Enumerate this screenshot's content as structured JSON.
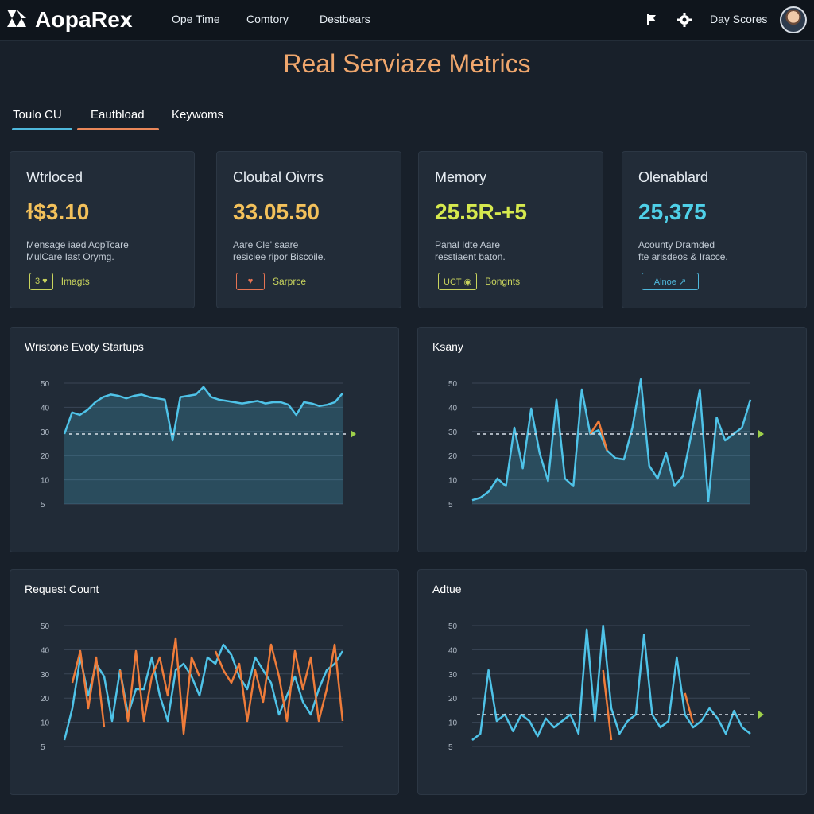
{
  "app": {
    "brand": "AopaRex"
  },
  "nav": {
    "items": [
      "Ope Time",
      "Comtory",
      "Destbears"
    ]
  },
  "header_right": {
    "day_scores": "Day Scores"
  },
  "page": {
    "title": "Real Serviaze Metrics"
  },
  "tabs": [
    {
      "label": "Toulo CU",
      "underline_color": "#4fb8dc"
    },
    {
      "label": "Eautbload",
      "underline_color": "#e9875a"
    },
    {
      "label": "Keywoms",
      "underline_color": ""
    }
  ],
  "cards": [
    {
      "title": "Wtrloced",
      "value": "ɫ$3.10",
      "value_color": "#f3c15b",
      "desc": [
        "Mensage iaed AopTcare",
        "MulCare Iast Orymg."
      ],
      "chip": "3 ♥",
      "chip_color": "#c9d45d",
      "action": "Imagts",
      "action_color": "#c9d45d"
    },
    {
      "title": "Cloubal Oivrrs",
      "value": "33.05.50",
      "value_color": "#f3c15b",
      "desc": [
        "Aare Cle' saare",
        "resiciee ripor Biscoile."
      ],
      "chip": "♥",
      "chip_color": "#e67453",
      "action": "Sarprce",
      "action_color": "#c9d45d"
    },
    {
      "title": "Memory",
      "value": "25.5R-+5",
      "value_color": "#d6e94e",
      "desc": [
        "Panal Idte Aare",
        "resstiaent baton."
      ],
      "chip": "UCT ◉",
      "chip_color": "#c9d45d",
      "action": "Bongnts",
      "action_color": "#c9d45d"
    },
    {
      "title": "Olenablard",
      "value": "25,375",
      "value_color": "#4fd0e8",
      "desc": [
        "Acounty Dramded",
        "fte arisdeos & Iracce."
      ],
      "chip": "Alnoe ↗",
      "chip_color": "#4fb8dc",
      "action": "",
      "action_color": "#c9d45d"
    }
  ],
  "charts": [
    {
      "title": "Wristone Evoty Startups"
    },
    {
      "title": "Ksany"
    },
    {
      "title": "Request Count"
    },
    {
      "title": "Adtue"
    }
  ],
  "colors": {
    "accent_blue": "#4fc3e8",
    "accent_orange": "#ef7c3a",
    "threshold": "#9ed04a"
  },
  "chart_data": [
    {
      "type": "area",
      "title": "Wristone Evoty Startups",
      "y_ticks": [
        "50",
        "40",
        "30",
        "20",
        "10",
        "5"
      ],
      "ylim": [
        0,
        100
      ],
      "threshold": 55,
      "series": [
        {
          "color": "#4fc3e8",
          "values": [
            55,
            72,
            70,
            74,
            80,
            84,
            86,
            85,
            83,
            85,
            86,
            84,
            83,
            82,
            50,
            84,
            85,
            86,
            92,
            84,
            82,
            81,
            80,
            79,
            80,
            81,
            79,
            80,
            80,
            78,
            70,
            80,
            79,
            77,
            78,
            80,
            87
          ]
        }
      ]
    },
    {
      "type": "area",
      "title": "Ksany",
      "y_ticks": [
        "50",
        "40",
        "30",
        "20",
        "10",
        "5"
      ],
      "ylim": [
        0,
        100
      ],
      "threshold": 55,
      "series": [
        {
          "color": "#4fc3e8",
          "values": [
            3,
            5,
            10,
            20,
            14,
            60,
            28,
            75,
            40,
            18,
            82,
            20,
            14,
            90,
            55,
            58,
            42,
            36,
            35,
            60,
            98,
            30,
            20,
            40,
            14,
            22,
            55,
            90,
            2,
            68,
            50,
            55,
            60,
            82
          ]
        },
        {
          "color": "#ef7c3a",
          "values": [
            null,
            null,
            null,
            null,
            null,
            null,
            null,
            null,
            null,
            null,
            null,
            null,
            null,
            null,
            55,
            65,
            42,
            null,
            null,
            null,
            null,
            null,
            null,
            null,
            null,
            null,
            null,
            null,
            null,
            null,
            null,
            null,
            null,
            null
          ]
        }
      ]
    },
    {
      "type": "line",
      "title": "Request Count",
      "y_ticks": [
        "50",
        "40",
        "30",
        "20",
        "10",
        "5"
      ],
      "ylim": [
        0,
        100
      ],
      "threshold": null,
      "series": [
        {
          "color": "#4fc3e8",
          "values": [
            5,
            30,
            70,
            40,
            65,
            55,
            20,
            60,
            25,
            45,
            45,
            70,
            40,
            20,
            60,
            65,
            55,
            40,
            70,
            65,
            80,
            72,
            55,
            45,
            70,
            60,
            50,
            25,
            40,
            55,
            35,
            25,
            45,
            60,
            65,
            75
          ]
        },
        {
          "color": "#ef7c3a",
          "values": [
            null,
            50,
            75,
            30,
            70,
            15,
            null,
            60,
            20,
            75,
            20,
            55,
            70,
            40,
            85,
            10,
            70,
            55,
            null,
            75,
            60,
            50,
            65,
            20,
            60,
            35,
            80,
            55,
            20,
            75,
            45,
            70,
            20,
            45,
            80,
            20
          ]
        }
      ]
    },
    {
      "type": "line",
      "title": "Adtue",
      "y_ticks": [
        "50",
        "40",
        "30",
        "20",
        "10",
        "5"
      ],
      "ylim": [
        0,
        100
      ],
      "threshold": 25,
      "series": [
        {
          "color": "#4fc3e8",
          "values": [
            5,
            10,
            60,
            20,
            25,
            12,
            25,
            20,
            8,
            22,
            15,
            20,
            25,
            10,
            92,
            20,
            95,
            30,
            10,
            20,
            25,
            88,
            25,
            15,
            20,
            70,
            25,
            15,
            20,
            30,
            22,
            10,
            28,
            15,
            10
          ]
        },
        {
          "color": "#ef7c3a",
          "values": [
            null,
            5,
            null,
            null,
            null,
            null,
            null,
            null,
            null,
            30,
            null,
            null,
            null,
            null,
            null,
            null,
            60,
            5,
            null,
            null,
            null,
            null,
            null,
            null,
            null,
            null,
            42,
            18,
            null,
            null,
            null,
            null,
            null,
            null,
            null
          ]
        }
      ]
    }
  ]
}
